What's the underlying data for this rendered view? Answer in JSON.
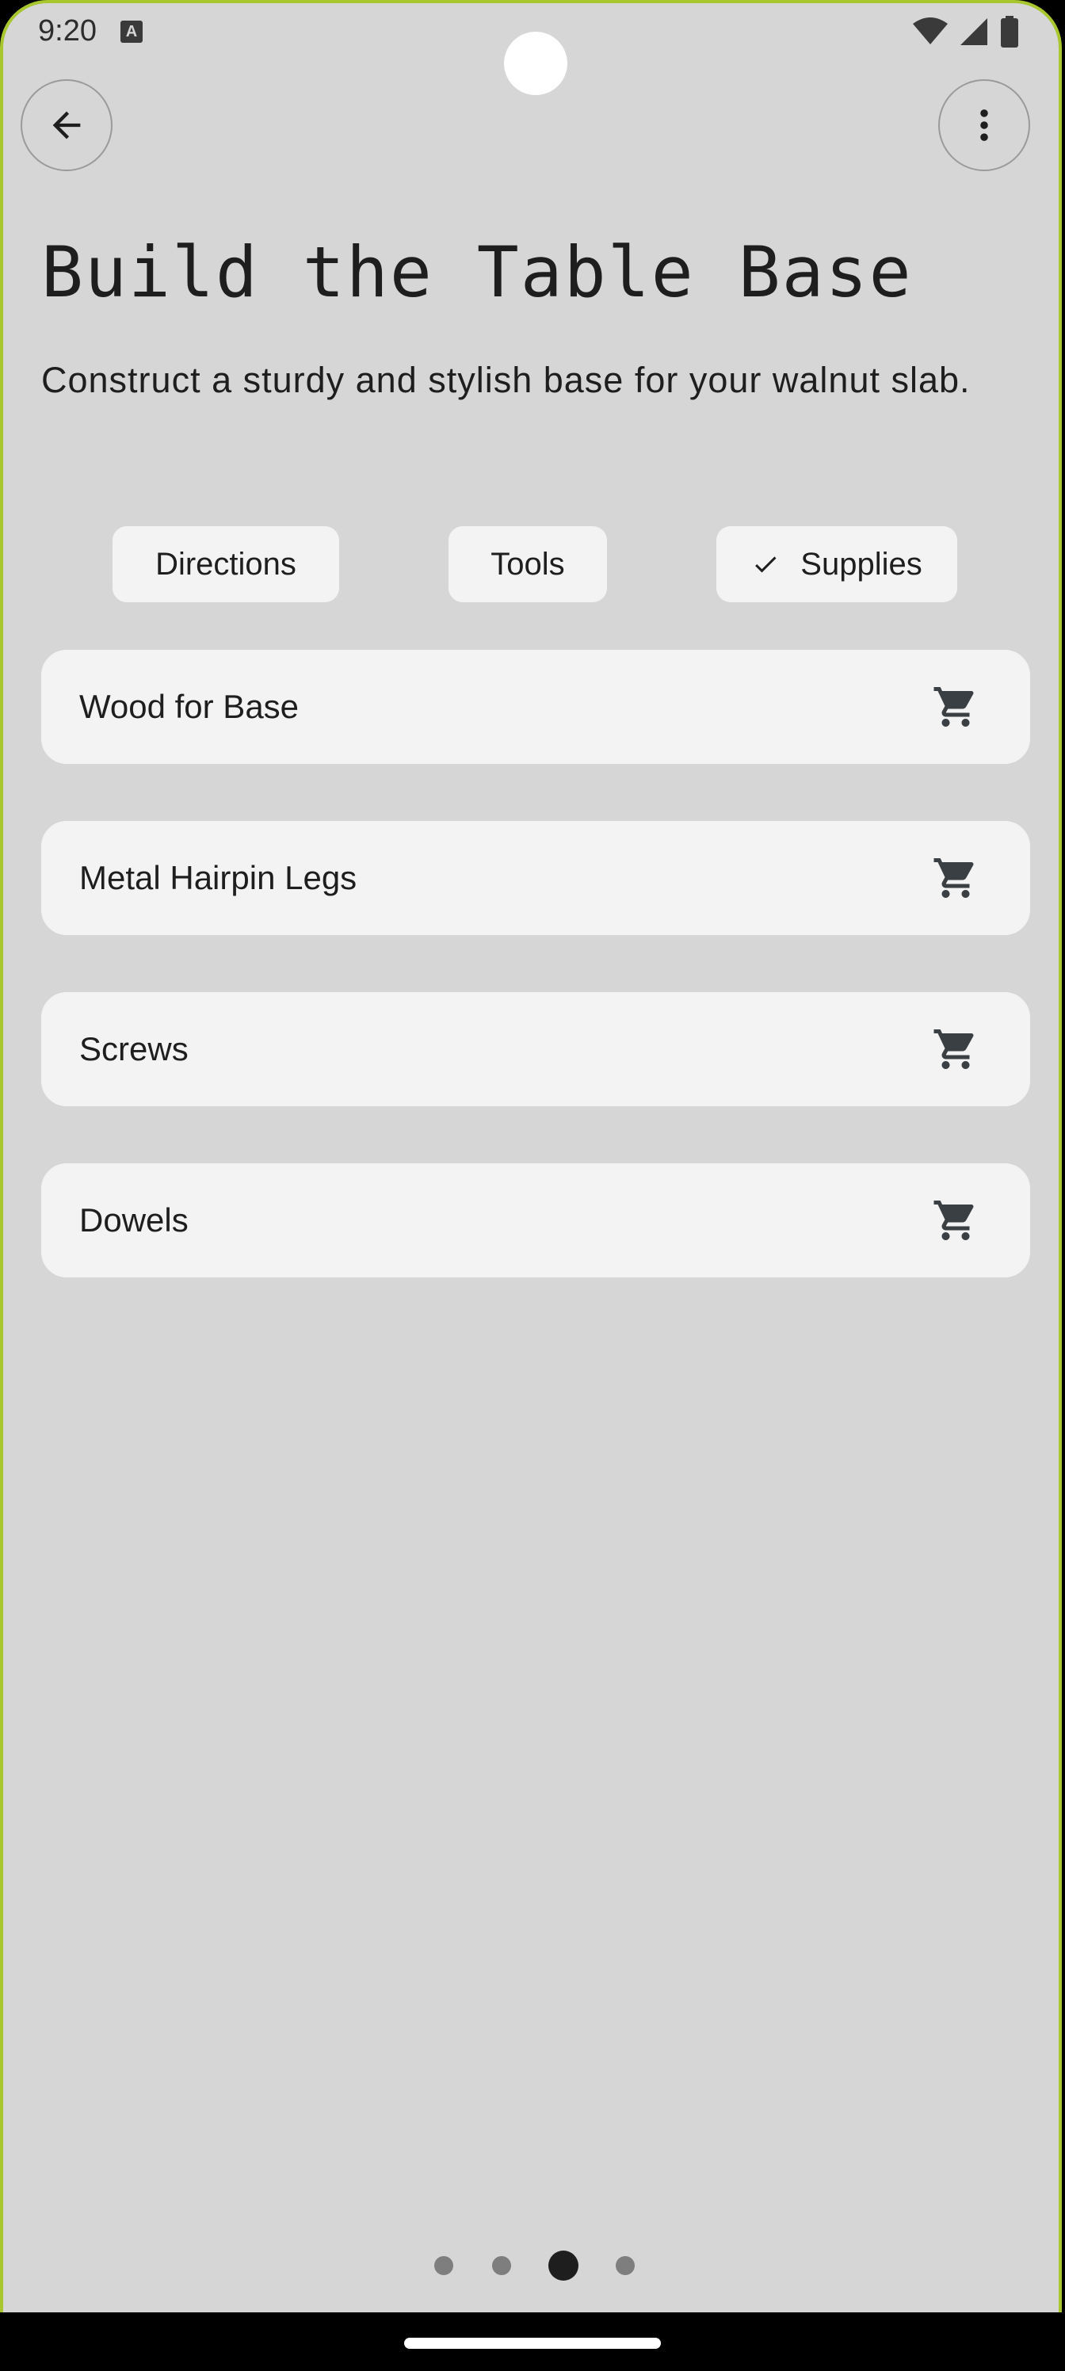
{
  "status_bar": {
    "time": "9:20",
    "icons": [
      "a-icon",
      "wifi-icon",
      "cell-signal-icon",
      "battery-icon"
    ]
  },
  "header": {
    "back_icon": "arrow-left-icon",
    "more_icon": "more-vert-icon"
  },
  "page": {
    "title": "Build the Table Base",
    "subtitle": "Construct a sturdy and stylish base for your walnut slab."
  },
  "tabs": [
    {
      "label": "Directions",
      "selected": false
    },
    {
      "label": "Tools",
      "selected": false
    },
    {
      "label": "Supplies",
      "selected": true
    }
  ],
  "supplies": [
    {
      "label": "Wood for Base",
      "icon": "cart-icon"
    },
    {
      "label": "Metal Hairpin Legs",
      "icon": "cart-icon"
    },
    {
      "label": "Screws",
      "icon": "cart-icon"
    },
    {
      "label": "Dowels",
      "icon": "cart-icon"
    }
  ],
  "pager": {
    "page_count": 4,
    "current_page": 3
  },
  "colors": {
    "background": "#d6d6d6",
    "surface": "#f3f3f3",
    "text": "#1e1e1e",
    "device_frame": "#a8c62e"
  }
}
